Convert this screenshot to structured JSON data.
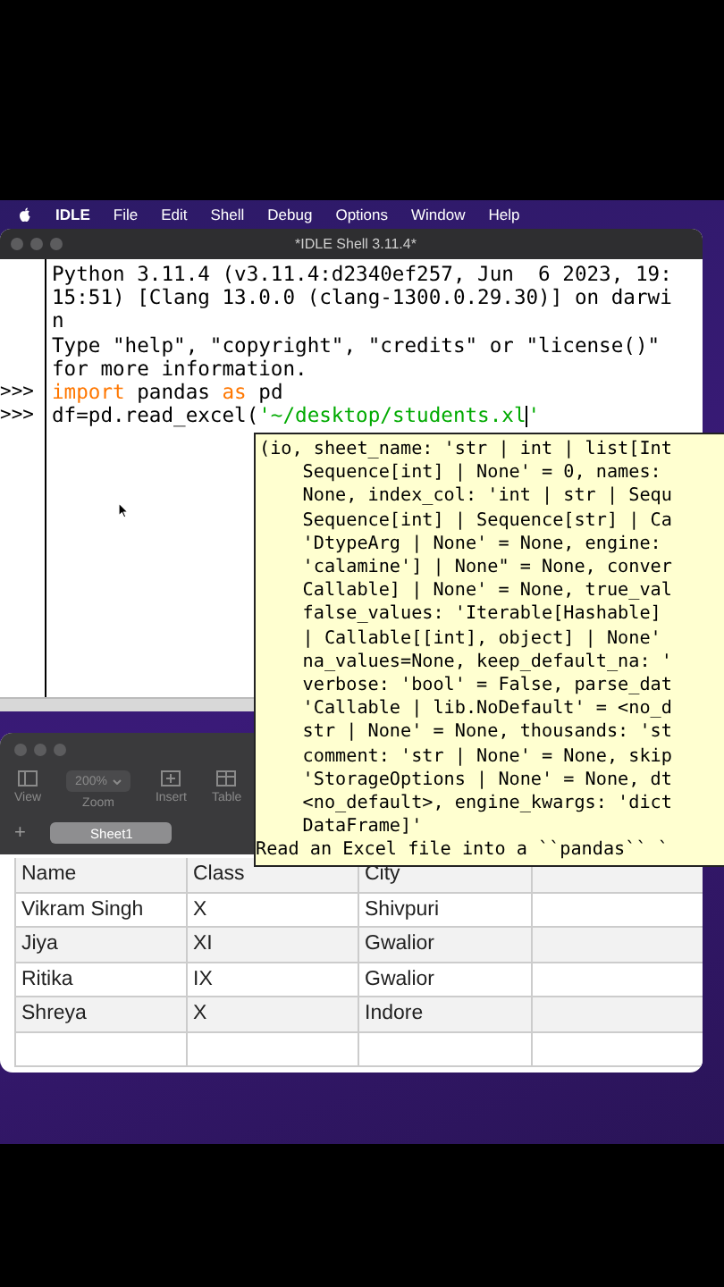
{
  "menu_bar": {
    "app": "IDLE",
    "items": [
      "File",
      "Edit",
      "Shell",
      "Debug",
      "Options",
      "Window",
      "Help"
    ]
  },
  "shell_window": {
    "title": "*IDLE Shell 3.11.4*",
    "lines": [
      {
        "segments": [
          {
            "kind": "plain",
            "text": "Python 3.11.4 (v3.11.4:d2340ef257, Jun  6 2023, 19:"
          }
        ]
      },
      {
        "segments": [
          {
            "kind": "plain",
            "text": "15:51) [Clang 13.0.0 (clang-1300.0.29.30)] on darwi"
          }
        ]
      },
      {
        "segments": [
          {
            "kind": "plain",
            "text": "n"
          }
        ]
      },
      {
        "segments": [
          {
            "kind": "plain",
            "text": "Type \"help\", \"copyright\", \"credits\" or \"license()\""
          }
        ]
      },
      {
        "segments": [
          {
            "kind": "plain",
            "text": "for more information."
          }
        ]
      },
      {
        "prompt": ">>>",
        "segments": [
          {
            "kind": "keyword",
            "text": "import"
          },
          {
            "kind": "plain",
            "text": " pandas "
          },
          {
            "kind": "keyword",
            "text": "as"
          },
          {
            "kind": "plain",
            "text": " pd"
          }
        ]
      },
      {
        "prompt": ">>>",
        "segments": [
          {
            "kind": "plain",
            "text": "df=pd.read_excel("
          },
          {
            "kind": "string",
            "text": "'~/desktop/students.xl"
          },
          {
            "kind": "caret"
          },
          {
            "kind": "string",
            "text": "'"
          }
        ]
      }
    ]
  },
  "calltip": {
    "lines": [
      "(io, sheet_name: 'str | int | list[Int",
      "    Sequence[int] | None' = 0, names:",
      "    None, index_col: 'int | str | Sequ",
      "    Sequence[int] | Sequence[str] | Ca",
      "    'DtypeArg | None' = None, engine:",
      "    'calamine'] | None\" = None, conver",
      "    Callable] | None' = None, true_val",
      "    false_values: 'Iterable[Hashable]",
      "    | Callable[[int], object] | None'",
      "    na_values=None, keep_default_na: '",
      "    verbose: 'bool' = False, parse_dat",
      "    'Callable | lib.NoDefault' = <no_d",
      "    str | None' = None, thousands: 'st",
      "    comment: 'str | None' = None, skip",
      "    'StorageOptions | None' = None, dt",
      "    <no_default>, engine_kwargs: 'dict",
      "    DataFrame]'"
    ],
    "summary": "Read an Excel file into a ``pandas`` `"
  },
  "numbers_window": {
    "toolbar": [
      {
        "kind": "sidebar",
        "label": "View"
      },
      {
        "kind": "zoom",
        "label": "Zoom",
        "value": "200%"
      },
      {
        "kind": "insert",
        "label": "Insert"
      },
      {
        "kind": "table",
        "label": "Table"
      }
    ],
    "add_sheet": "+",
    "sheets": [
      {
        "label": "Sheet1",
        "selected": true
      }
    ],
    "rows": [
      [
        "Name",
        "Class",
        "City"
      ],
      [
        "Vikram Singh",
        "X",
        "Shivpuri"
      ],
      [
        "Jiya",
        "XI",
        "Gwalior"
      ],
      [
        "Ritika",
        "IX",
        "Gwalior"
      ],
      [
        "Shreya",
        "X",
        "Indore"
      ]
    ]
  }
}
